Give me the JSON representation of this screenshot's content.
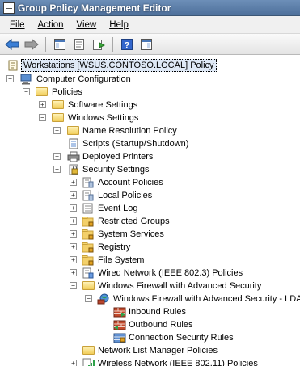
{
  "window": {
    "title": "Group Policy Management Editor"
  },
  "menu": {
    "file": "File",
    "action": "Action",
    "view": "View",
    "help": "Help"
  },
  "toolbar": {
    "icons": [
      "back-arrow-icon",
      "forward-arrow-icon",
      "show-hide-tree-icon",
      "properties-icon",
      "export-list-icon",
      "help-icon",
      "show-action-pane-icon"
    ]
  },
  "tree": {
    "root": "Workstations [WSUS.CONTOSO.LOCAL] Policy",
    "computer_configuration": "Computer Configuration",
    "policies": "Policies",
    "software_settings": "Software Settings",
    "windows_settings": "Windows Settings",
    "name_resolution_policy": "Name Resolution Policy",
    "scripts": "Scripts (Startup/Shutdown)",
    "deployed_printers": "Deployed Printers",
    "security_settings": "Security Settings",
    "account_policies": "Account Policies",
    "local_policies": "Local Policies",
    "event_log": "Event Log",
    "restricted_groups": "Restricted Groups",
    "system_services": "System Services",
    "registry": "Registry",
    "file_system": "File System",
    "wired_network": "Wired Network (IEEE 802.3) Policies",
    "windows_firewall": "Windows Firewall with Advanced Security",
    "windows_firewall_ldap": "Windows Firewall with Advanced Security - LDAP",
    "inbound_rules": "Inbound Rules",
    "outbound_rules": "Outbound Rules",
    "connection_security_rules": "Connection Security Rules",
    "network_list_manager": "Network List Manager Policies",
    "wireless_network": "Wireless Network (IEEE 802.11) Policies"
  }
}
